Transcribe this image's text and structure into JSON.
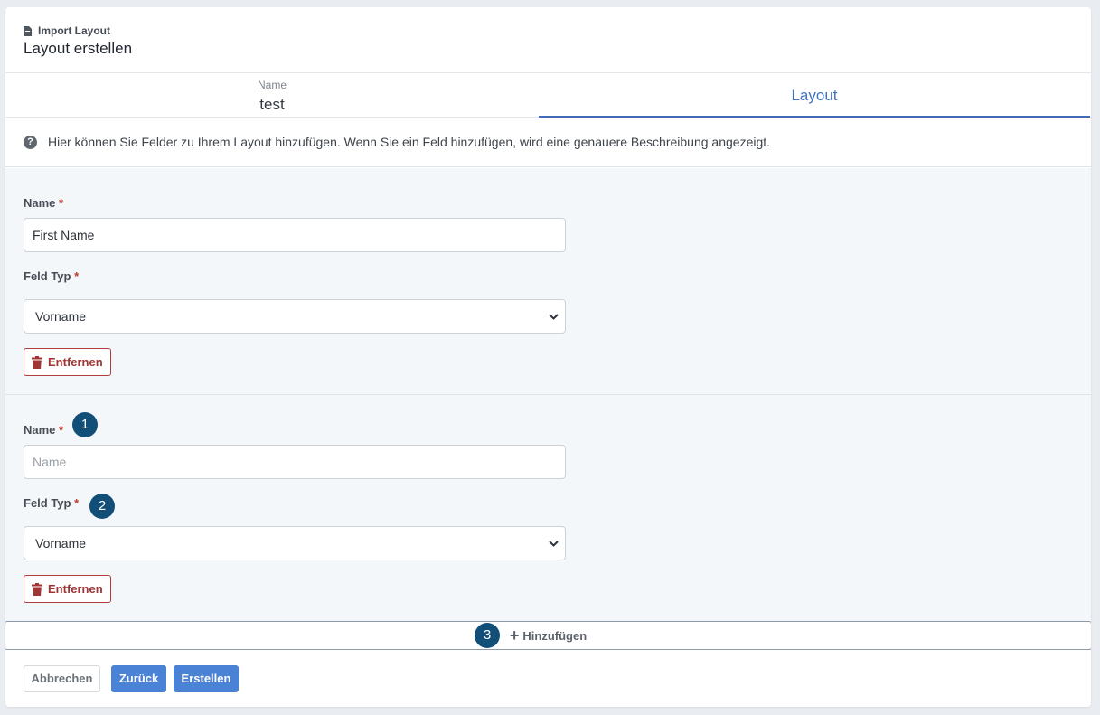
{
  "header": {
    "subtitle": "Import Layout",
    "title": "Layout erstellen"
  },
  "tabs": {
    "name_label": "Name",
    "name_value": "test",
    "layout_label": "Layout"
  },
  "help_text": "Hier können Sie Felder zu Ihrem Layout hinzufügen. Wenn Sie ein Feld hinzufügen, wird eine genauere Beschreibung angezeigt.",
  "fields": [
    {
      "name_label": "Name",
      "required_mark": "*",
      "name_value": "First Name",
      "type_label": "Feld Typ",
      "type_value": "Vorname",
      "remove_label": "Entfernen"
    },
    {
      "name_label": "Name",
      "required_mark": "*",
      "name_placeholder": "Name",
      "type_label": "Feld Typ",
      "type_value": "Vorname",
      "remove_label": "Entfernen"
    }
  ],
  "badges": [
    "1",
    "2",
    "3"
  ],
  "add_label": "Hinzufügen",
  "footer": {
    "cancel": "Abbrechen",
    "back": "Zurück",
    "create": "Erstellen"
  },
  "colors": {
    "accent": "#4a82d6",
    "danger": "#a13434",
    "badge": "#114f78"
  }
}
